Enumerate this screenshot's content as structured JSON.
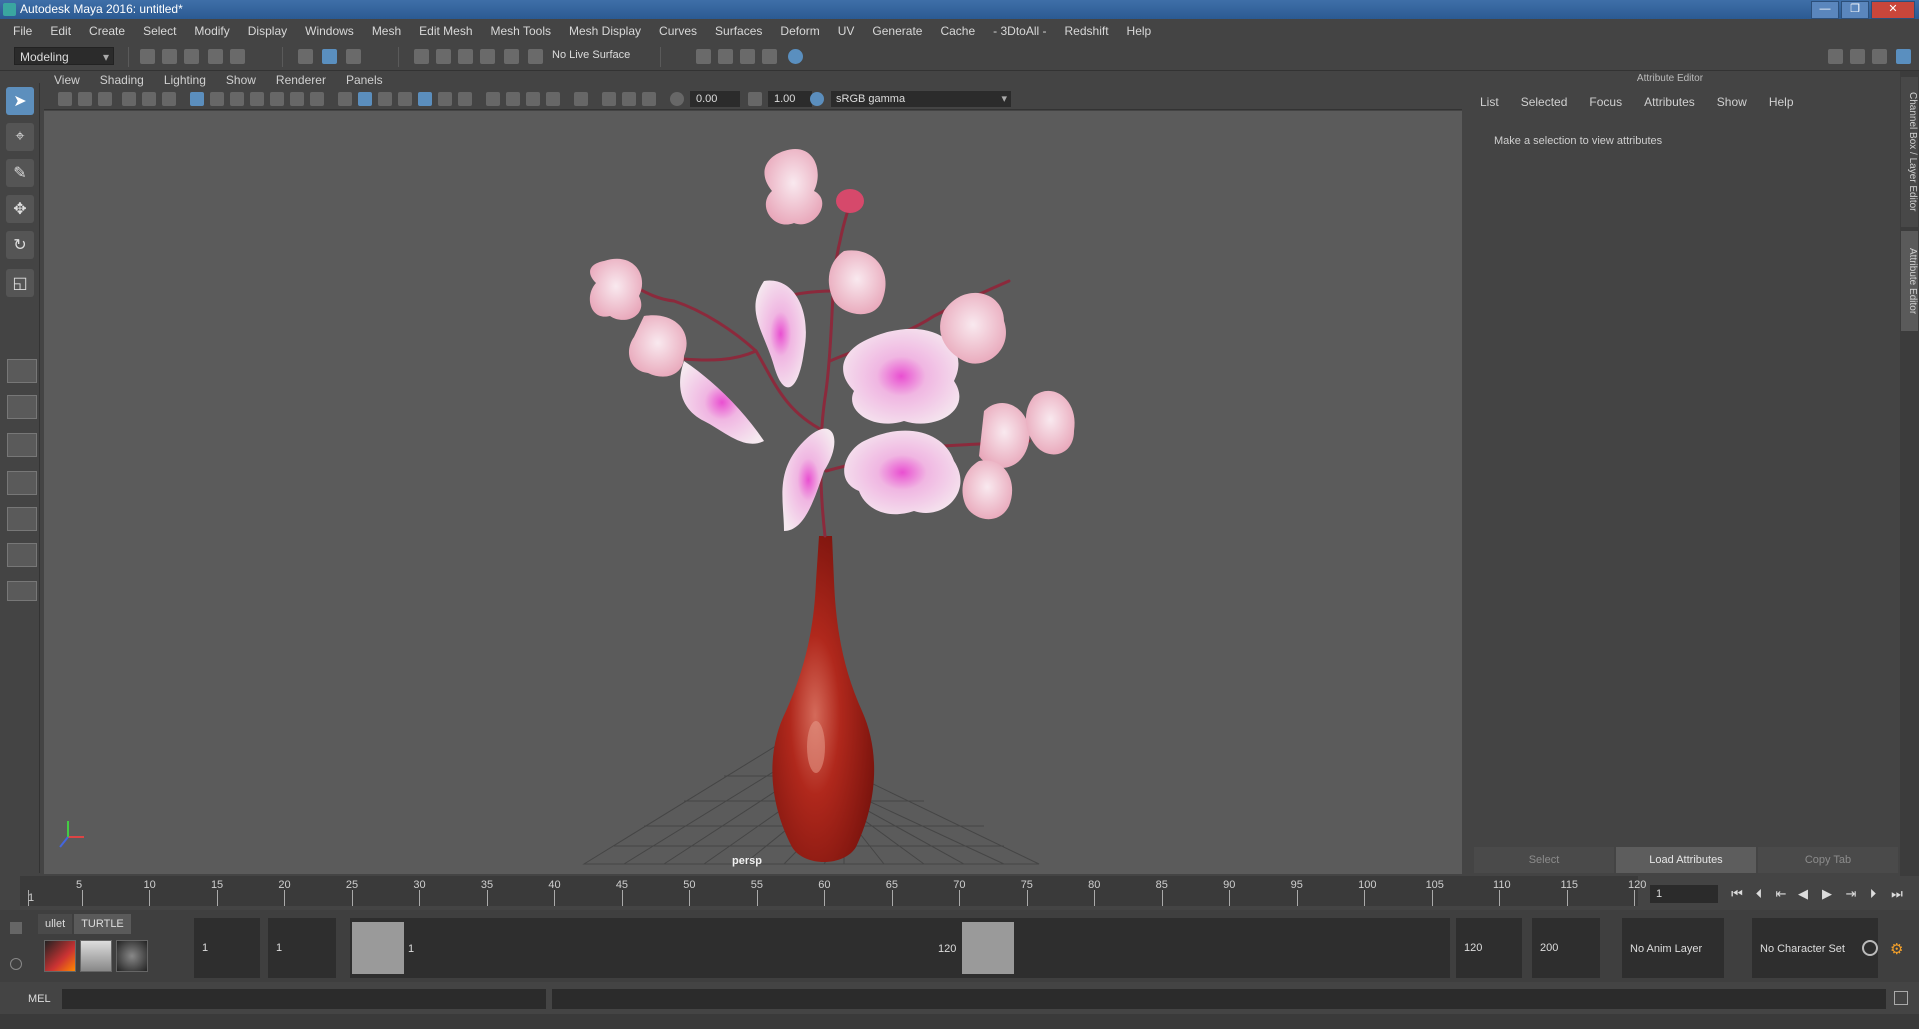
{
  "window": {
    "title": "Autodesk Maya 2016: untitled*",
    "min": "—",
    "max": "❐",
    "close": "✕"
  },
  "menubar": [
    "File",
    "Edit",
    "Create",
    "Select",
    "Modify",
    "Display",
    "Windows",
    "Mesh",
    "Edit Mesh",
    "Mesh Tools",
    "Mesh Display",
    "Curves",
    "Surfaces",
    "Deform",
    "UV",
    "Generate",
    "Cache",
    "- 3DtoAll -",
    "Redshift",
    "Help"
  ],
  "statusline": {
    "menuset": "Modeling",
    "live_surface": "No Live Surface"
  },
  "panel": {
    "menus": [
      "View",
      "Shading",
      "Lighting",
      "Show",
      "Renderer",
      "Panels"
    ],
    "exposure": "0.00",
    "gamma": "1.00",
    "colorspace": "sRGB gamma",
    "camera": "persp"
  },
  "attribute_editor": {
    "title": "Attribute Editor",
    "menus": [
      "List",
      "Selected",
      "Focus",
      "Attributes",
      "Show",
      "Help"
    ],
    "message": "Make a selection to view attributes",
    "buttons": [
      "Select",
      "Load Attributes",
      "Copy Tab"
    ],
    "side_tabs": [
      "Channel Box / Layer Editor",
      "Attribute Editor"
    ]
  },
  "timeslider": {
    "ticks": [
      1,
      5,
      10,
      15,
      20,
      25,
      30,
      35,
      40,
      45,
      50,
      55,
      60,
      65,
      70,
      75,
      80,
      85,
      90,
      95,
      100,
      105,
      110,
      115,
      120
    ],
    "labels": [
      "5",
      "10",
      "15",
      "20",
      "25",
      "30",
      "35",
      "40",
      "45",
      "50",
      "55",
      "60",
      "65",
      "70",
      "75",
      "80",
      "85",
      "90",
      "95",
      "100",
      "105",
      "110",
      "115",
      "120"
    ],
    "start_marker": "1",
    "current_frame": "1"
  },
  "shelf": {
    "tabs": [
      "ullet",
      "TURTLE"
    ]
  },
  "range": {
    "start": "1",
    "range_start": "1",
    "handle_start_label": "1",
    "handle_end_label": "120",
    "range_end": "120",
    "end": "200",
    "anim_layer": "No Anim Layer",
    "character_set": "No Character Set"
  },
  "commandline": {
    "label": "MEL"
  }
}
